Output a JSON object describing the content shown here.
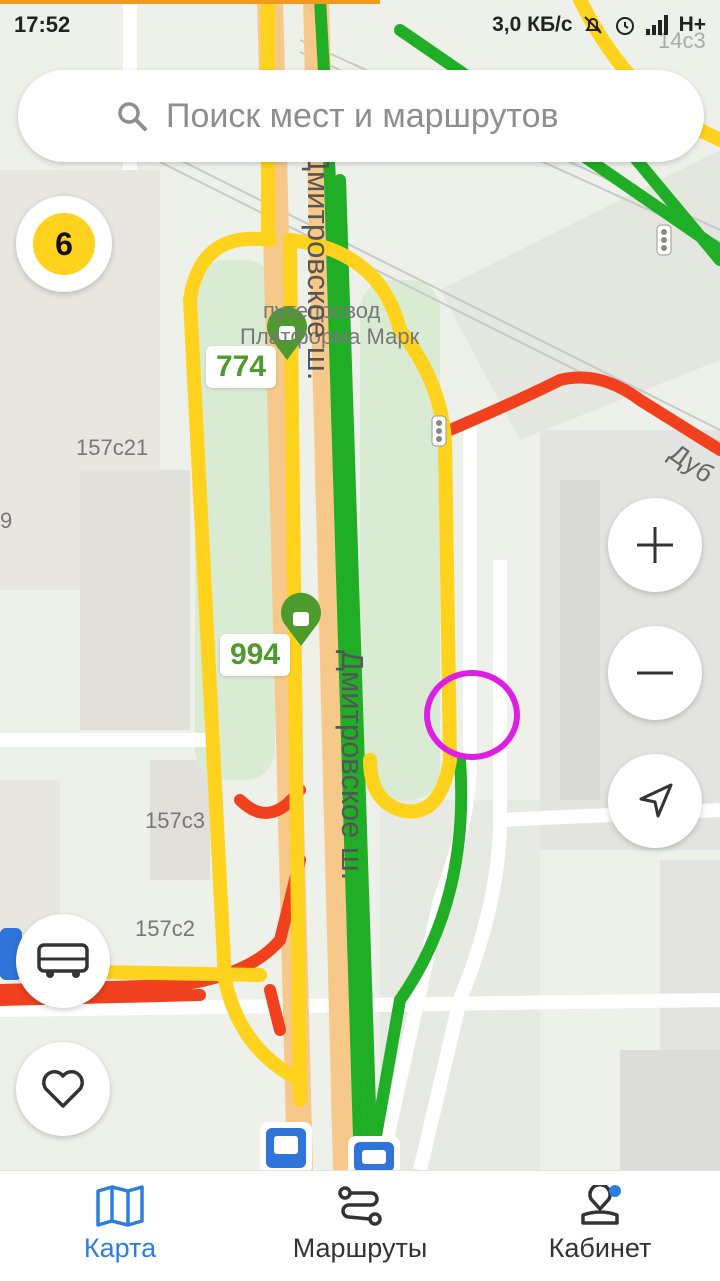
{
  "status_bar": {
    "time": "17:52",
    "network_speed": "3,0 КБ/с",
    "network_type": "H+",
    "icons": [
      "alarm-off-icon",
      "alarm-clock-icon",
      "signal-icon"
    ]
  },
  "search": {
    "placeholder": "Поиск мест и маршрутов",
    "icon": "search-icon"
  },
  "traffic_level": "6",
  "map": {
    "labels": {
      "overpass_line1": "путепровод",
      "overpass_line2": "Платформа Марк",
      "building_157c21": "157с21",
      "building_157c3": "157с3",
      "building_157c2": "157с2",
      "building_14c3": "14с3",
      "partial_9": "9",
      "street_dmitrovskoe": "Дмитровское ш.",
      "street_top": "Дмитровское ш.",
      "street_dub": "Дуб"
    },
    "transit_routes": [
      {
        "number": "774"
      },
      {
        "number": "994"
      }
    ]
  },
  "controls": {
    "zoom_in": "zoom-in-icon",
    "zoom_out": "zoom-out-icon",
    "locate": "locate-icon",
    "transport": "bus-icon",
    "favorites": "heart-icon"
  },
  "bottom_nav": {
    "items": [
      {
        "label": "Карта",
        "icon": "map-icon",
        "active": true
      },
      {
        "label": "Маршруты",
        "icon": "routes-icon",
        "active": false
      },
      {
        "label": "Кабинет",
        "icon": "profile-icon",
        "active": false
      }
    ]
  },
  "colors": {
    "accent": "#2c7fe0",
    "traffic_yellow": "#ffd21e",
    "traffic_green": "#1fae26",
    "traffic_red": "#f0401e",
    "route_green": "#4d9a2d",
    "highlight": "#dd1fe6"
  }
}
